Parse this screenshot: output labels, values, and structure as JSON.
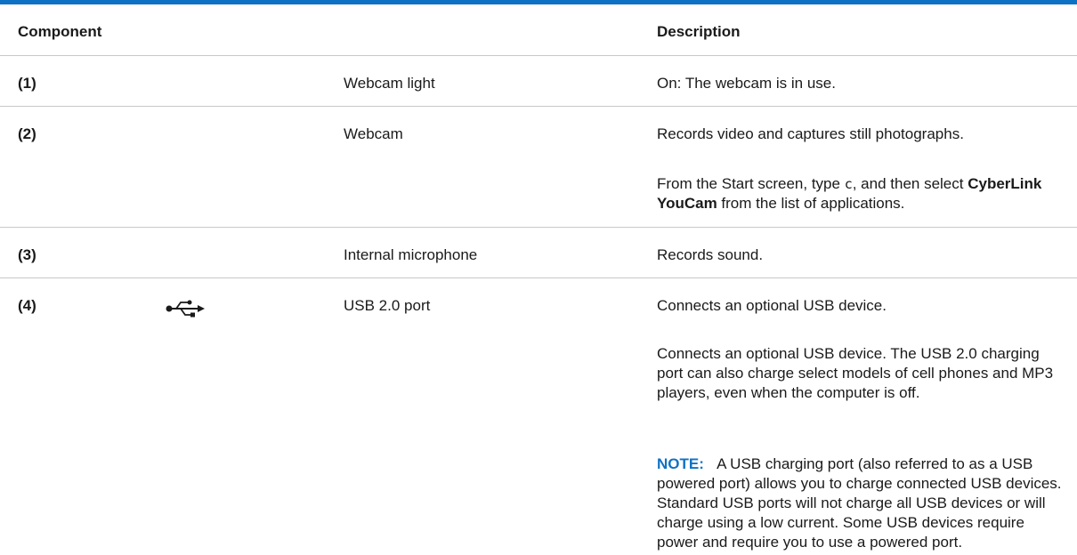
{
  "header": {
    "component": "Component",
    "description": "Description"
  },
  "rows": [
    {
      "number": "(1)",
      "component": "Webcam light",
      "descriptions": [
        "On: The webcam is in use."
      ]
    },
    {
      "number": "(2)",
      "component": "Webcam",
      "descriptions": [
        "Records video and captures still photographs."
      ],
      "start_screen": {
        "before": "From the Start screen, type ",
        "typed_char": "c",
        "middle": ", and then select ",
        "app_name": "CyberLink YouCam",
        "after": " from the list of applications."
      }
    },
    {
      "number": "(3)",
      "component": "Internal microphone",
      "descriptions": [
        "Records sound."
      ]
    },
    {
      "number": "(4)",
      "icon": "usb-icon",
      "component": "USB 2.0 port",
      "descriptions": [
        "Connects an optional USB device.",
        "Connects an optional USB device. The USB 2.0 charging port can also charge select models of cell phones and MP3 players, even when the computer is off."
      ],
      "note": {
        "label": "NOTE:",
        "text": "A USB charging port (also referred to as a USB powered port) allows you to charge connected USB devices. Standard USB ports will not charge all USB devices or will charge using a low current. Some USB devices require power and require you to use a powered port."
      }
    }
  ],
  "colors": {
    "accent": "#0e72c4",
    "rule": "#c8c8c8",
    "text": "#1a1a1a"
  }
}
